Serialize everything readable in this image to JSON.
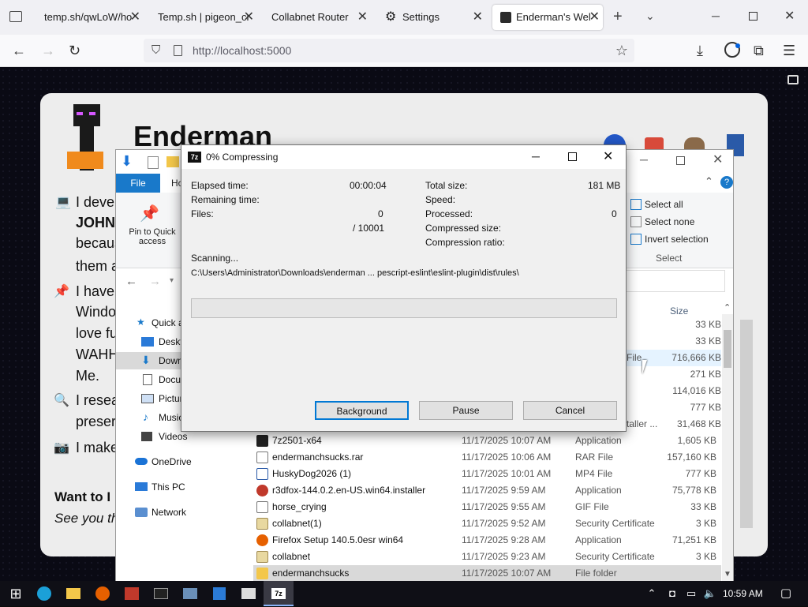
{
  "browser": {
    "tabs": [
      {
        "label": "temp.sh/qwLoW/ho"
      },
      {
        "label": "Temp.sh | pigeon_cr"
      },
      {
        "label": "Collabnet Router"
      },
      {
        "label": "Settings"
      },
      {
        "label": "Enderman's Wel"
      }
    ],
    "new_tab": "+",
    "url": "http://localhost:5000"
  },
  "website": {
    "title": "Enderman",
    "lines": [
      {
        "text": "I devel"
      },
      {
        "text": "JOHN"
      },
      {
        "text": "becaus"
      },
      {
        "text": "them a"
      },
      {
        "text": "I have"
      },
      {
        "text": "Windo"
      },
      {
        "text": "love fu"
      },
      {
        "text": "WAHH"
      },
      {
        "text": "Me."
      },
      {
        "text": "I resea"
      },
      {
        "text": "preser"
      },
      {
        "text": "I make"
      }
    ],
    "want_to": "Want to I",
    "see_you": "See you th"
  },
  "explorer": {
    "file_tab": "File",
    "home_tab": "Ho",
    "pin_label": "Pin to Quick access",
    "select_all": "Select all",
    "select_none": "Select none",
    "invert_selection": "Invert selection",
    "select_group": "Select",
    "size_header": "Size",
    "nav": [
      {
        "label": "Quick a"
      },
      {
        "label": "Deskt"
      },
      {
        "label": "Down"
      },
      {
        "label": "Docu"
      },
      {
        "label": "Pictur"
      },
      {
        "label": "Music"
      },
      {
        "label": "Videos"
      },
      {
        "label": "OneDrive"
      },
      {
        "label": "This PC"
      },
      {
        "label": "Network"
      }
    ],
    "partial_rows": [
      {
        "type": "",
        "size": "33 KB"
      },
      {
        "type": "",
        "size": "33 KB"
      },
      {
        "type": "File",
        "size": "716,666 KB"
      },
      {
        "type": "",
        "size": "271 KB"
      },
      {
        "type": "",
        "size": "114,016 KB"
      },
      {
        "type": "",
        "size": "777 KB"
      },
      {
        "type": "taller ...",
        "size": "31,468 KB"
      }
    ],
    "rows": [
      {
        "name": "7z2501-x64",
        "date": "11/17/2025 10:07 AM",
        "type": "Application",
        "size": "1,605 KB",
        "color": "#222222"
      },
      {
        "name": "endermanchsucks.rar",
        "date": "11/17/2025 10:06 AM",
        "type": "RAR File",
        "size": "157,160 KB",
        "color": "#ffffff"
      },
      {
        "name": "HuskyDog2026 (1)",
        "date": "11/17/2025 10:01 AM",
        "type": "MP4 File",
        "size": "777 KB",
        "color": "#2a5aa8"
      },
      {
        "name": "r3dfox-144.0.2.en-US.win64.installer",
        "date": "11/17/2025 9:59 AM",
        "type": "Application",
        "size": "75,778 KB",
        "color": "#c0392b"
      },
      {
        "name": "horse_crying",
        "date": "11/17/2025 9:55 AM",
        "type": "GIF File",
        "size": "33 KB",
        "color": "#ffffff"
      },
      {
        "name": "collabnet(1)",
        "date": "11/17/2025 9:52 AM",
        "type": "Security Certificate",
        "size": "3 KB",
        "color": "#e8d8a0"
      },
      {
        "name": "Firefox Setup 140.5.0esr win64",
        "date": "11/17/2025 9:28 AM",
        "type": "Application",
        "size": "71,251 KB",
        "color": "#e66000"
      },
      {
        "name": "collabnet",
        "date": "11/17/2025 9:23 AM",
        "type": "Security Certificate",
        "size": "3 KB",
        "color": "#e8d8a0"
      },
      {
        "name": "endermanchsucks",
        "date": "11/17/2025 10:07 AM",
        "type": "File folder",
        "size": "",
        "color": "#f3c74a"
      }
    ]
  },
  "dialog": {
    "app_icon": "7z",
    "title": "0% Compressing",
    "elapsed_label": "Elapsed time:",
    "elapsed_value": "00:00:04",
    "remaining_label": "Remaining time:",
    "files_label": "Files:",
    "files_value": "0",
    "files_total": "/ 10001",
    "total_size_label": "Total size:",
    "total_size_value": "181 MB",
    "speed_label": "Speed:",
    "processed_label": "Processed:",
    "processed_value": "0",
    "compressed_size_label": "Compressed size:",
    "compression_ratio_label": "Compression ratio:",
    "scanning_label": "Scanning...",
    "path": "C:\\Users\\Administrator\\Downloads\\enderman ... pescript-eslint\\eslint-plugin\\dist\\rules\\",
    "progress": 0,
    "background_btn": "Background",
    "pause_btn": "Pause",
    "cancel_btn": "Cancel"
  },
  "taskbar": {
    "time": "10:59 AM",
    "zip_label": "7z"
  },
  "colors": {
    "accent": "#0078d4",
    "tab_bar": "#f0f0f4",
    "page_bg": "#0a0a14",
    "card_bg": "#ededed"
  }
}
